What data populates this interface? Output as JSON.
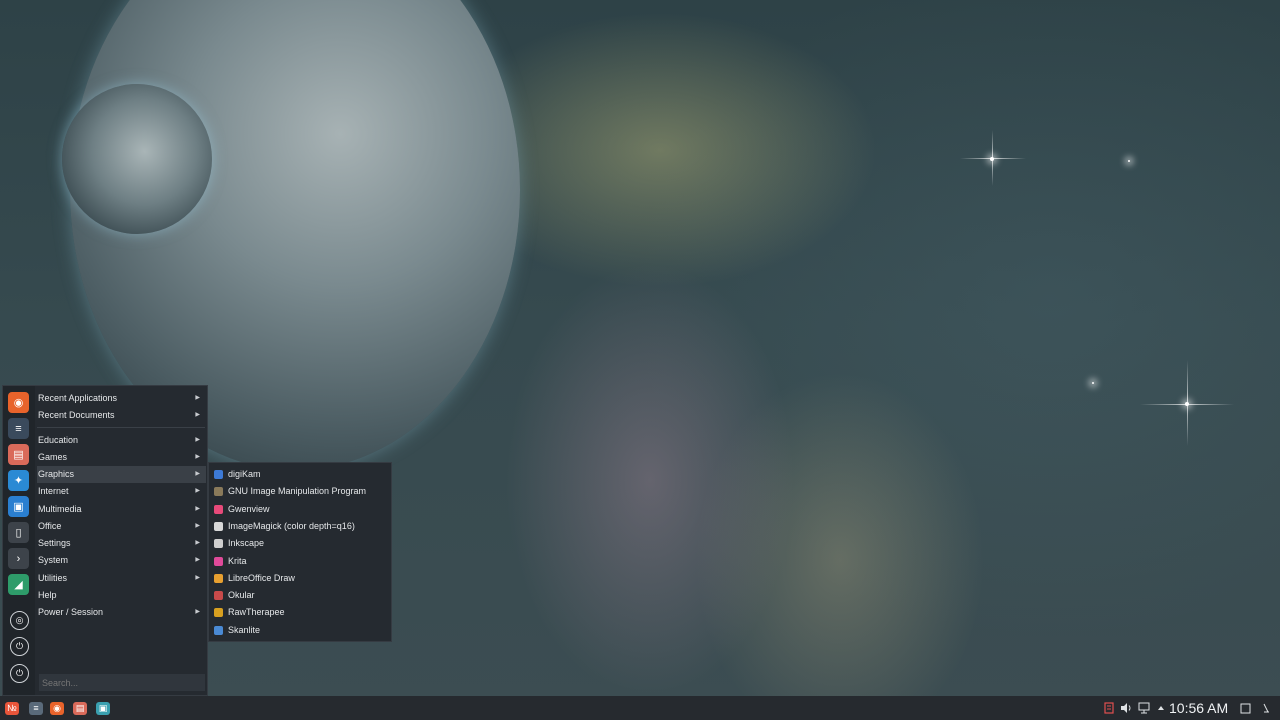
{
  "start_menu": {
    "left_icons": [
      {
        "name": "firefox-icon",
        "color": "#e8632b"
      },
      {
        "name": "system-settings-icon",
        "color": "#3a4a5c"
      },
      {
        "name": "file-manager-icon",
        "color": "#d96a5a"
      },
      {
        "name": "browser-icon",
        "color": "#2a8ad4"
      },
      {
        "name": "software-store-icon",
        "color": "#2a7fd0"
      },
      {
        "name": "notes-icon",
        "color": "#3d434a"
      },
      {
        "name": "terminal-icon",
        "color": "#3d434a"
      },
      {
        "name": "system-monitor-icon",
        "color": "#2e9c6a"
      },
      {
        "name": "lock-screen-icon",
        "color": "#2a2f35"
      },
      {
        "name": "logout-icon",
        "color": "#2a2f35"
      },
      {
        "name": "shutdown-icon",
        "color": "#2a2f35"
      }
    ],
    "items": [
      {
        "label": "Recent Applications",
        "has_submenu": true
      },
      {
        "label": "Recent Documents",
        "has_submenu": true
      },
      {
        "label": "Education",
        "has_submenu": true
      },
      {
        "label": "Games",
        "has_submenu": true
      },
      {
        "label": "Graphics",
        "has_submenu": true,
        "highlighted": true
      },
      {
        "label": "Internet",
        "has_submenu": true
      },
      {
        "label": "Multimedia",
        "has_submenu": true
      },
      {
        "label": "Office",
        "has_submenu": true
      },
      {
        "label": "Settings",
        "has_submenu": true
      },
      {
        "label": "System",
        "has_submenu": true
      },
      {
        "label": "Utilities",
        "has_submenu": true
      },
      {
        "label": "Help",
        "has_submenu": false
      },
      {
        "label": "Power / Session",
        "has_submenu": true
      }
    ],
    "search_placeholder": "Search..."
  },
  "graphics_submenu": {
    "items": [
      {
        "label": "digiKam",
        "icon": "digikam-icon",
        "color": "#3d7ad6"
      },
      {
        "label": "GNU Image Manipulation Program",
        "icon": "gimp-icon",
        "color": "#8a7a5a"
      },
      {
        "label": "Gwenview",
        "icon": "gwenview-icon",
        "color": "#e84a7a"
      },
      {
        "label": "ImageMagick (color depth=q16)",
        "icon": "imagemagick-icon",
        "color": "#d8d8d8"
      },
      {
        "label": "Inkscape",
        "icon": "inkscape-icon",
        "color": "#cfcfcf"
      },
      {
        "label": "Krita",
        "icon": "krita-icon",
        "color": "#e04a9a"
      },
      {
        "label": "LibreOffice Draw",
        "icon": "libreoffice-draw-icon",
        "color": "#e8a030"
      },
      {
        "label": "Okular",
        "icon": "okular-icon",
        "color": "#c84a4a"
      },
      {
        "label": "RawTherapee",
        "icon": "rawtherapee-icon",
        "color": "#d8a020"
      },
      {
        "label": "Skanlite",
        "icon": "skanlite-icon",
        "color": "#4a8ad4"
      }
    ]
  },
  "taskbar": {
    "launchers": [
      {
        "name": "app-launcher-icon",
        "color": "#e8553a"
      },
      {
        "name": "settings-launcher-icon",
        "color": "#5a6a7a"
      },
      {
        "name": "firefox-taskbar-icon",
        "color": "#e8632b"
      },
      {
        "name": "files-taskbar-icon",
        "color": "#d96a5a"
      },
      {
        "name": "monitor-taskbar-icon",
        "color": "#3aa0b0"
      }
    ],
    "clock": "10:56 AM"
  }
}
